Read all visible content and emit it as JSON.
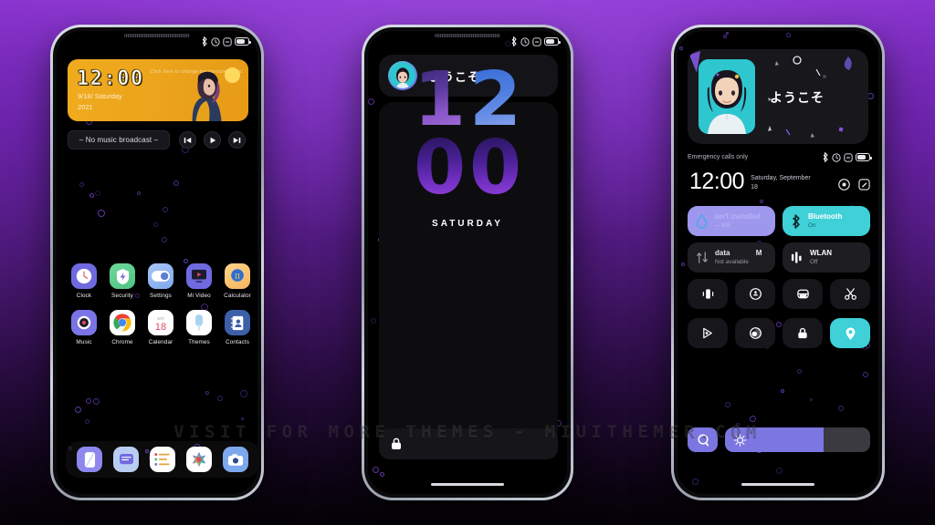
{
  "watermark": "VISIT FOR MORE THEMES - MIUITHEMER.COM",
  "theme": {
    "background_top": "#8a35cf",
    "background_bottom": "#050207",
    "accent_purple": "#7b76e0",
    "accent_teal": "#3fd0d8",
    "widget_yellow": "#eca51c"
  },
  "phone1": {
    "name": "Home screen",
    "status_icons": [
      "bluetooth-icon",
      "alarm-icon",
      "dnd-icon",
      "battery-icon"
    ],
    "clock_widget": {
      "time": "12:00",
      "date": "9/18/ Saturday",
      "year": "2021",
      "hint": "Click here to change background music"
    },
    "music_bar": {
      "label": "–  No music broadcast  –",
      "buttons": [
        "previous-track-button",
        "play-button",
        "next-track-button"
      ]
    },
    "apps": [
      {
        "label": "Clock",
        "icon": "clock-icon"
      },
      {
        "label": "Security",
        "icon": "shield-icon"
      },
      {
        "label": "Settings",
        "icon": "toggle-icon"
      },
      {
        "label": "Mi Video",
        "icon": "video-icon"
      },
      {
        "label": "Calculator",
        "icon": "calculator-icon"
      },
      {
        "label": "Music",
        "icon": "music-icon"
      },
      {
        "label": "Chrome",
        "icon": "chrome-icon"
      },
      {
        "label": "Calendar",
        "icon": "calendar-icon"
      },
      {
        "label": "Themes",
        "icon": "themes-icon"
      },
      {
        "label": "Contacts",
        "icon": "contacts-icon"
      }
    ],
    "calendar_icon": {
      "weekday": "SAT",
      "day": "18"
    },
    "dock": [
      {
        "label": "Phone",
        "icon": "phone-icon"
      },
      {
        "label": "Messages",
        "icon": "messages-icon"
      },
      {
        "label": "Notes",
        "icon": "notes-icon"
      },
      {
        "label": "Gallery",
        "icon": "gallery-icon"
      },
      {
        "label": "Camera",
        "icon": "camera-icon"
      }
    ]
  },
  "phone2": {
    "name": "Lock screen",
    "status_icons": [
      "bluetooth-icon",
      "alarm-icon",
      "dnd-icon",
      "battery-icon"
    ],
    "welcome": "ようこそ",
    "clock": {
      "hours": "12",
      "minutes": "00",
      "h1": "1",
      "h2": "2",
      "m1": "0",
      "m2": "0"
    },
    "weekday": "SATURDAY",
    "lock_hint_icon": "lock-icon"
  },
  "phone3": {
    "name": "Notification shade",
    "greeting": "ようこそ",
    "carrier": "Emergency calls only",
    "status_icons": [
      "bluetooth-icon",
      "alarm-icon",
      "dnd-icon",
      "battery-icon"
    ],
    "time": "12:00",
    "date": "Saturday, September 18",
    "header_actions": [
      "settings-icon",
      "edit-icon"
    ],
    "tiles": [
      {
        "title": "isn't installed",
        "subtitle": "— MB",
        "icon": "cleaner-icon",
        "state": "on",
        "color": "#9e97ee"
      },
      {
        "title": "Bluetooth",
        "subtitle": "On",
        "icon": "bluetooth-icon",
        "state": "on",
        "color": "#3fd0d8"
      },
      {
        "title": "data",
        "subtitle": "Not available",
        "icon": "data-icon",
        "state": "off",
        "color": "#1d1d22"
      },
      {
        "title": "WLAN",
        "subtitle": "Off",
        "icon": "wlan-icon",
        "state": "off",
        "color": "#1d1d22"
      }
    ],
    "tile3_suffix": "M",
    "toggles": [
      {
        "icon": "vibrate-icon",
        "state": "off"
      },
      {
        "icon": "flashlight-icon",
        "state": "off"
      },
      {
        "icon": "dark-mode-icon",
        "state": "off"
      },
      {
        "icon": "screenshot-icon",
        "state": "off"
      },
      {
        "icon": "cast-icon",
        "state": "off"
      },
      {
        "icon": "brightness-icon",
        "state": "off"
      },
      {
        "icon": "lock-icon",
        "state": "off"
      },
      {
        "icon": "location-icon",
        "state": "on"
      }
    ],
    "brightness": {
      "value": 68,
      "assistant_icon": "assistant-icon",
      "slider_icon": "brightness-sun-icon"
    }
  }
}
